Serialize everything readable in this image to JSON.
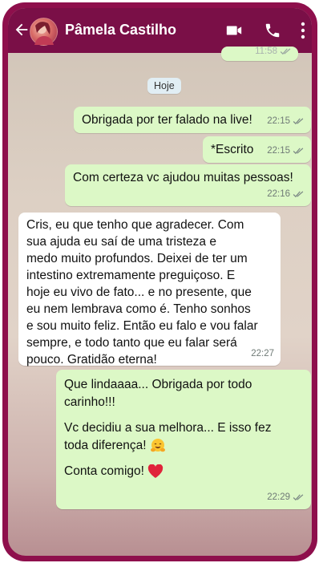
{
  "header": {
    "contact_name": "Pâmela Castilho",
    "icons": [
      "back-arrow-icon",
      "avatar",
      "video-call-icon",
      "phone-icon",
      "more-vert-icon"
    ]
  },
  "chat": {
    "previous_time": "11:58",
    "day_label": "Hoje",
    "messages": [
      {
        "dir": "out",
        "text": "Obrigada por ter falado na live!",
        "time": "22:15",
        "status": "read"
      },
      {
        "dir": "out",
        "text": "*Escrito",
        "time": "22:15",
        "status": "read"
      },
      {
        "dir": "out",
        "text": "Com certeza vc ajudou muitas pessoas!",
        "time": "22:16",
        "status": "read"
      },
      {
        "dir": "in",
        "lines": [
          "Cris, eu que tenho que agradecer. Com",
          "sua ajuda eu saí de uma tristeza e",
          "medo muito profundos. Deixei de ter um",
          "intestino extremamente preguiçoso. E",
          "hoje eu vivo de fato... e no presente, que",
          "eu nem lembrava como é. Tenho sonhos",
          "e sou muito feliz. Então eu falo e vou falar",
          "sempre, e todo tanto que eu falar será",
          "pouco. Gratidão eterna!"
        ],
        "time": "22:27"
      },
      {
        "dir": "out",
        "lines": [
          "Que lindaaaa... Obrigada por todo",
          "carinho!!!",
          "",
          "Vc decidiu a sua melhora... E isso fez",
          "toda diferença!",
          "",
          "Conta comigo!"
        ],
        "emojis": [
          "hugging-face-emoji",
          "red-heart-emoji"
        ],
        "time": "22:29",
        "status": "read"
      }
    ]
  },
  "colors": {
    "frame": "#8e0f4c",
    "appbar": "#7a0f47",
    "outgoing_bubble": "#dcf8c6",
    "incoming_bubble": "#ffffff",
    "tick": "#7d8b86"
  }
}
